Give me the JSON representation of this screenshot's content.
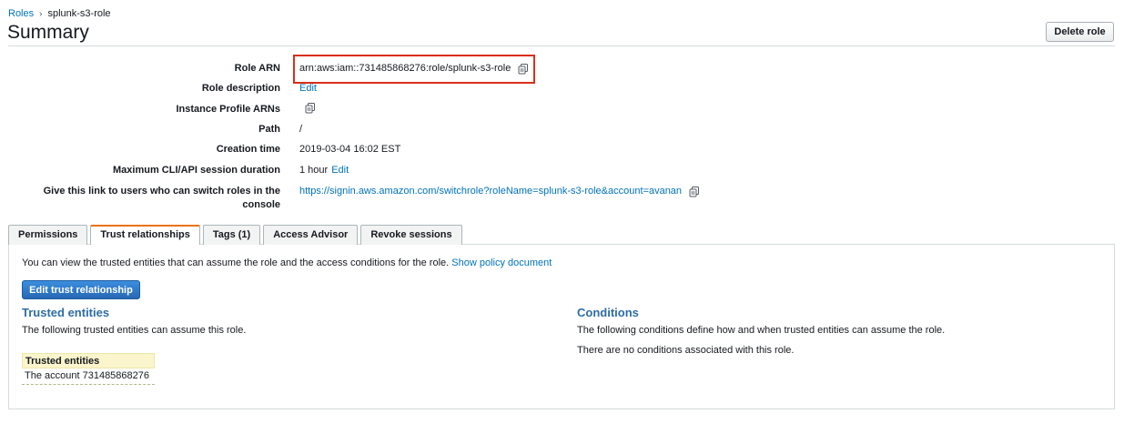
{
  "breadcrumb": {
    "root": "Roles",
    "current": "splunk-s3-role"
  },
  "header": {
    "title": "Summary",
    "delete_label": "Delete role"
  },
  "summary": {
    "role_arn_label": "Role ARN",
    "role_arn_value": "arn:aws:iam::731485868276:role/splunk-s3-role",
    "role_description_label": "Role description",
    "role_description_edit": "Edit",
    "instance_profile_label": "Instance Profile ARNs",
    "path_label": "Path",
    "path_value": "/",
    "creation_time_label": "Creation time",
    "creation_time_value": "2019-03-04 16:02 EST",
    "max_session_label": "Maximum CLI/API session duration",
    "max_session_value": "1 hour",
    "max_session_edit": "Edit",
    "switch_link_label_line1": "Give this link to users who can switch roles in the",
    "switch_link_label_line2": "console",
    "switch_link_value": "https://signin.aws.amazon.com/switchrole?roleName=splunk-s3-role&account=avanan"
  },
  "tabs": [
    {
      "label": "Permissions",
      "active": false
    },
    {
      "label": "Trust relationships",
      "active": true
    },
    {
      "label": "Tags (1)",
      "active": false
    },
    {
      "label": "Access Advisor",
      "active": false
    },
    {
      "label": "Revoke sessions",
      "active": false
    }
  ],
  "trust": {
    "intro_text": "You can view the trusted entities that can assume the role and the access conditions for the role.",
    "show_policy_link": "Show policy document",
    "edit_button": "Edit trust relationship",
    "trusted_heading": "Trusted entities",
    "trusted_desc": "The following trusted entities can assume this role.",
    "table_header": "Trusted entities",
    "table_rows": [
      "The account 731485868276"
    ],
    "conditions_heading": "Conditions",
    "conditions_desc": "The following conditions define how and when trusted entities can assume the role.",
    "no_conditions": "There are no conditions associated with this role."
  },
  "colors": {
    "link": "#0073bb",
    "active_tab_accent": "#ec7211",
    "highlight_box": "#d9301b",
    "primary_button": "#2868b4",
    "section_heading": "#2e6da4"
  },
  "icons": {
    "copy": "copy-icon",
    "breadcrumb_separator": "chevron-right-icon"
  }
}
